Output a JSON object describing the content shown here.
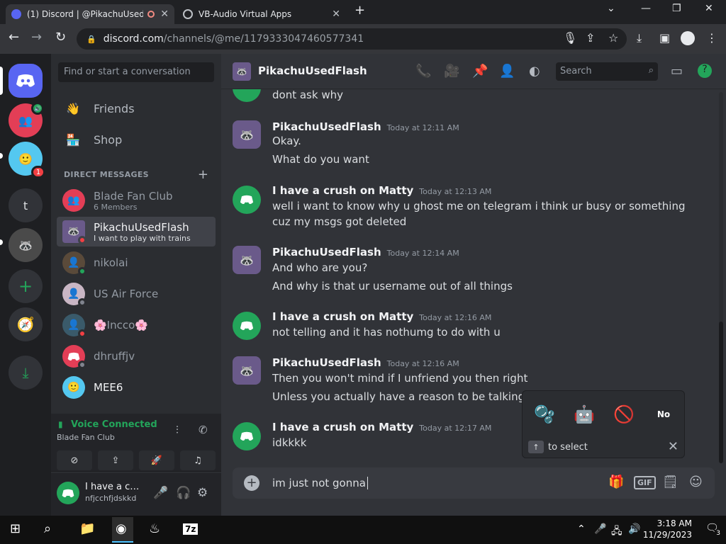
{
  "browser": {
    "tabs": [
      {
        "title": "(1) Discord | @PikachuUsedFlash",
        "active": true
      },
      {
        "title": "VB-Audio Virtual Apps",
        "active": false
      }
    ],
    "url_host": "discord.com",
    "url_path": "/channels/@me/1179333047460577341"
  },
  "servers": [
    {
      "name": "home",
      "badge": ""
    },
    {
      "name": "voice-user",
      "badge": ""
    },
    {
      "name": "server-face",
      "badge": "1"
    },
    {
      "name": "t",
      "letter": "t"
    },
    {
      "name": "server-raccoon",
      "badge": ""
    }
  ],
  "dm_panel": {
    "search_placeholder": "Find or start a conversation",
    "nav": [
      {
        "label": "Friends"
      },
      {
        "label": "Shop"
      }
    ],
    "header": "DIRECT MESSAGES",
    "dms": [
      {
        "name": "Blade Fan Club",
        "sub": "6 Members"
      },
      {
        "name": "PikachuUsedFlash",
        "sub": "I want to play with trains"
      },
      {
        "name": "nikolai",
        "sub": ""
      },
      {
        "name": "US Air Force",
        "sub": ""
      },
      {
        "name": "🌸Incco🌸",
        "sub": ""
      },
      {
        "name": "dhruffjv",
        "sub": ""
      },
      {
        "name": "MEE6",
        "sub": ""
      }
    ],
    "voice": {
      "status": "Voice Connected",
      "channel": "Blade Fan Club"
    },
    "user": {
      "name": "I have a crush on Matty",
      "tag": "nfjcchfjdskkd"
    }
  },
  "chat": {
    "title": "PikachuUsedFlash",
    "search_placeholder": "Search",
    "top_line": "dont ask why",
    "groups": [
      {
        "author": "PikachuUsedFlash",
        "time": "Today at 12:11 AM",
        "lines": [
          "Okay.",
          "What do you want"
        ]
      },
      {
        "author": "I have a crush on Matty",
        "time": "Today at 12:13 AM",
        "lines": [
          "well i want to know why u ghost me on telegram i think ur busy or something cuz my msgs got deleted"
        ]
      },
      {
        "author": "PikachuUsedFlash",
        "time": "Today at 12:14 AM",
        "lines": [
          "And who are you?",
          "And why is that ur username out of all things"
        ]
      },
      {
        "author": "I have a crush on Matty",
        "time": "Today at 12:16 AM",
        "lines": [
          "not telling and it has nothumg to do with u"
        ]
      },
      {
        "author": "PikachuUsedFlash",
        "time": "Today at 12:16 AM",
        "lines": [
          "Then you won't mind if I unfriend you then right",
          "Unless you actually have a reason to be talking to me"
        ]
      },
      {
        "author": "I have a crush on Matty",
        "time": "Today at 12:17 AM",
        "lines": [
          "idkkkk"
        ]
      }
    ],
    "draft": "im just not gonna",
    "sticker_hint": "to select",
    "sticker_badge": "No"
  },
  "taskbar": {
    "time": "3:18 AM",
    "date": "11/29/2023",
    "notifications": "3"
  }
}
